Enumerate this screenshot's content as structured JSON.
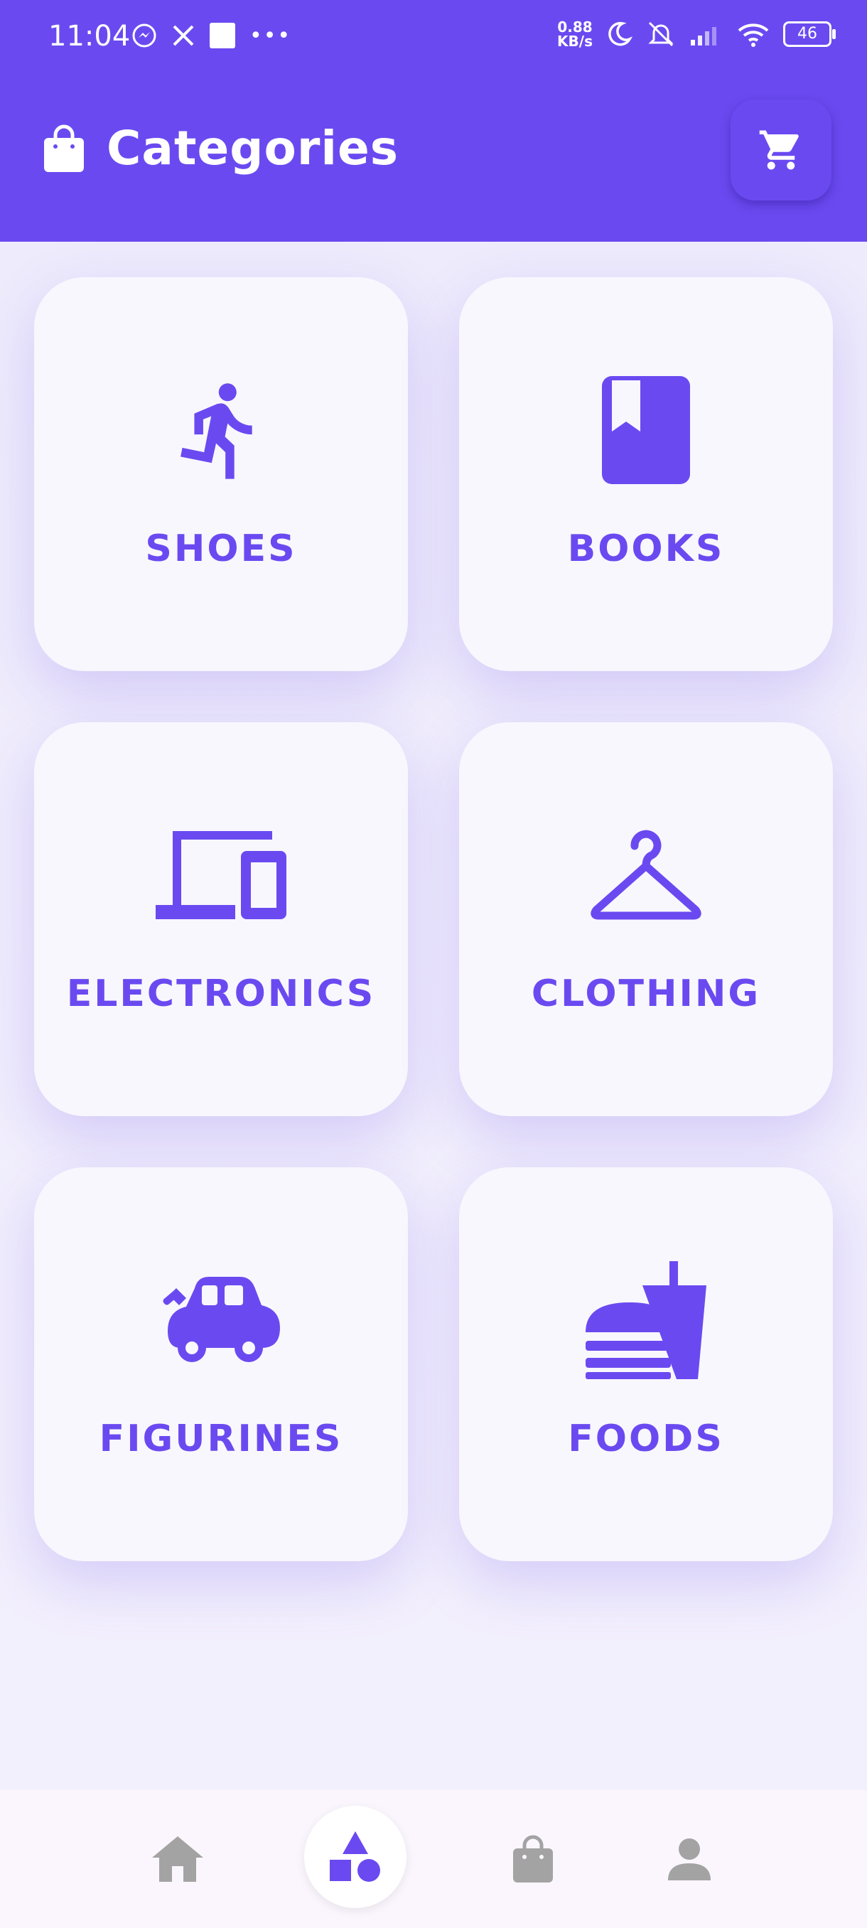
{
  "status_bar": {
    "time": "11:04",
    "net_speed_value": "0.88",
    "net_speed_unit": "KB/s",
    "battery": "46"
  },
  "header": {
    "title": "Categories",
    "icon": "shopping-bag-icon",
    "cart_icon": "cart-icon"
  },
  "categories": [
    {
      "label": "SHOES",
      "icon": "running-person-icon"
    },
    {
      "label": "BOOKS",
      "icon": "book-icon"
    },
    {
      "label": "ELECTRONICS",
      "icon": "devices-icon"
    },
    {
      "label": "CLOTHING",
      "icon": "hanger-icon"
    },
    {
      "label": "FIGURINES",
      "icon": "toy-car-icon"
    },
    {
      "label": "FOODS",
      "icon": "fastfood-icon"
    }
  ],
  "bottom_nav": [
    {
      "name": "home",
      "icon": "home-icon",
      "active": false
    },
    {
      "name": "categories",
      "icon": "category-shapes-icon",
      "active": true
    },
    {
      "name": "orders",
      "icon": "shopping-bag-icon",
      "active": false
    },
    {
      "name": "profile",
      "icon": "person-icon",
      "active": false
    }
  ],
  "colors": {
    "primary": "#6A4AF0",
    "card": "#F8F7FE",
    "background": "#F4F1FD",
    "nav_inactive": "#A3A3A3"
  }
}
